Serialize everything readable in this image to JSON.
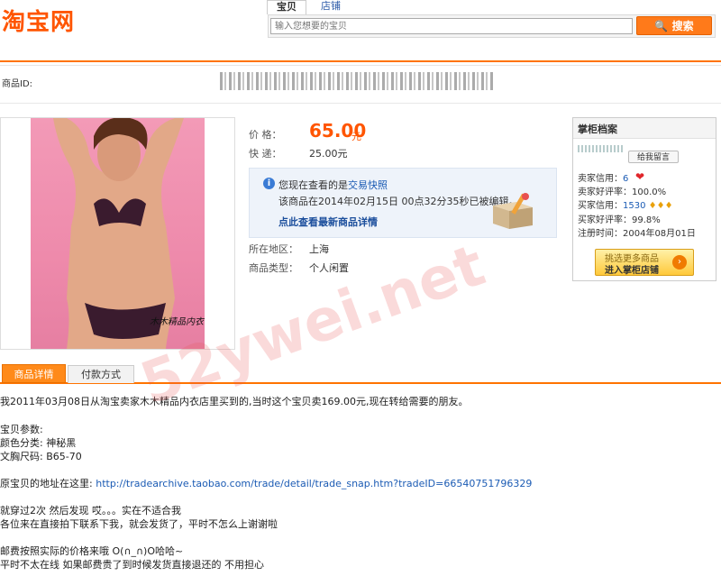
{
  "header": {
    "logo": "淘宝网",
    "tabs": [
      "宝贝",
      "店铺"
    ],
    "search_placeholder": "输入您想要的宝贝",
    "search_button": "搜索"
  },
  "item": {
    "id_label": "商品ID:",
    "price_label": "价    格：",
    "price": "65.00",
    "price_unit": "元",
    "shipping_label": "快    递：",
    "shipping": "25.00元",
    "location_label": "所在地区：",
    "location": "上海",
    "type_label": "商品类型：",
    "type": "个人闲置",
    "photo_caption": "木木精品内衣"
  },
  "notice": {
    "line1_prefix": "您现在查看的是",
    "line1_link": "交易快照",
    "line2": "该商品在2014年02月15日 00点32分35秒已被编辑。",
    "link": "点此查看最新商品详情"
  },
  "seller": {
    "title": "掌柜档案",
    "message_button": "给我留言",
    "seller_credit_label": "卖家信用：",
    "seller_credit": "6",
    "seller_rate_label": "卖家好评率：",
    "seller_rate": "100.0%",
    "buyer_credit_label": "买家信用：",
    "buyer_credit": "1530",
    "buyer_rate_label": "买家好评率：",
    "buyer_rate": "99.8%",
    "reg_label": "注册时间：",
    "reg_date": "2004年08月01日",
    "shop_btn_l1": "挑选更多商品",
    "shop_btn_l2": "进入掌柜店铺"
  },
  "detail_tabs": [
    "商品详情",
    "付款方式"
  ],
  "description": {
    "line1": "我2011年03月08日从淘宝卖家木木精品内衣店里买到的,当时这个宝贝卖169.00元,现在转给需要的朋友。",
    "params_title": "宝贝参数:",
    "color": "颜色分类: 神秘黑",
    "size": "文胸尺码: B65-70",
    "source_label": "原宝贝的地址在这里:",
    "source_url": "http://tradearchive.taobao.com/trade/detail/trade_snap.htm?tradeID=66540751796329",
    "l_worn": "就穿过2次 然后发现  哎。。。实在不适合我",
    "l_contact": "各位来在直接拍下联系下我，就会发货了，平时不怎么上谢谢啦",
    "l_postage": " 邮费按照实际的价格来哦  O(∩_∩)O哈哈~",
    "l_offline": "平时不太在线  如果邮费贵了到时候发货直接退还的  不用担心"
  },
  "watermark": "52ywei.net",
  "colors": {
    "accent": "#ff7300",
    "price": "#ff5500",
    "link": "#1b5bb4"
  }
}
